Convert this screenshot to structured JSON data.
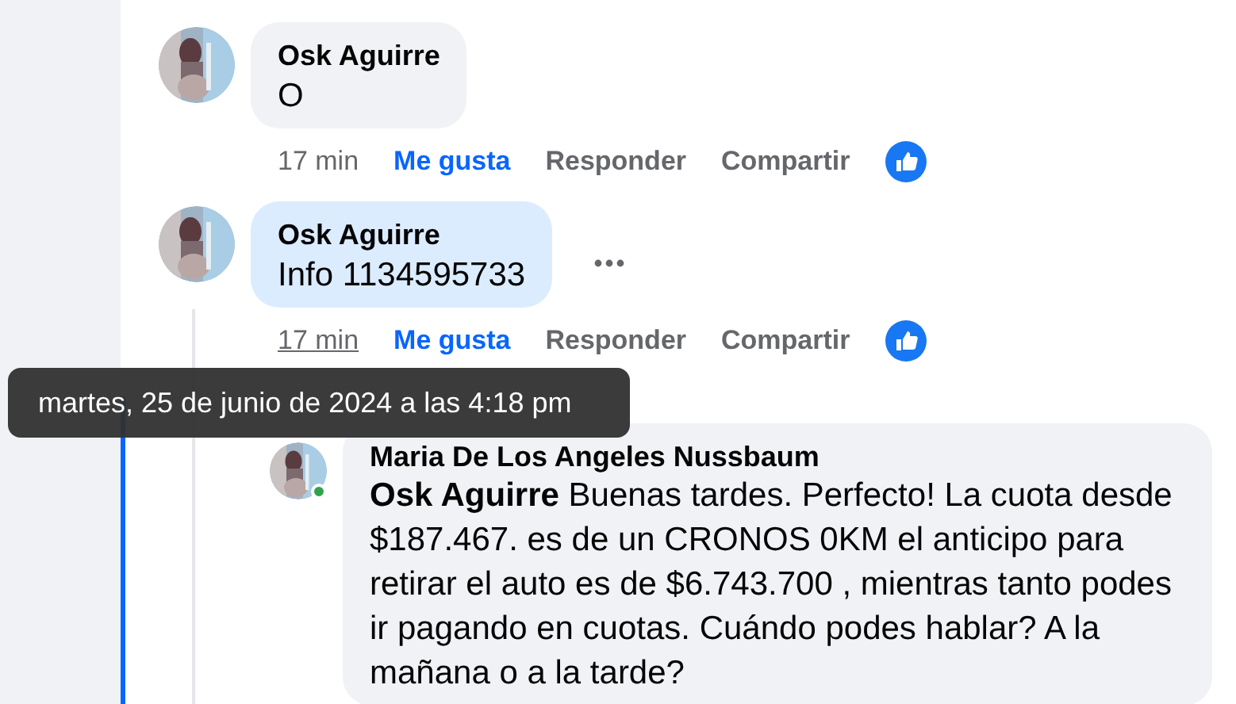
{
  "comments": [
    {
      "author": "Osk Aguirre",
      "text": "O",
      "highlighted": false,
      "time": "17 min",
      "time_hovered": false,
      "actions": [
        {
          "label": "Me gusta",
          "active": true
        },
        {
          "label": "Responder",
          "active": false
        },
        {
          "label": "Compartir",
          "active": false
        }
      ],
      "reacted": true
    },
    {
      "author": "Osk Aguirre",
      "text": "Info 1134595733",
      "highlighted": true,
      "more_menu": true,
      "time": "17 min",
      "time_hovered": true,
      "actions": [
        {
          "label": "Me gusta",
          "active": true
        },
        {
          "label": "Responder",
          "active": false
        },
        {
          "label": "Compartir",
          "active": false
        }
      ],
      "reacted": true
    },
    {
      "author": "Maria De Los Angeles Nussbaum",
      "text": "**Osk Aguirre** Buenas tardes. Perfecto! La cuota desde $187.467. es de un CRONOS 0KM el anticipo para retirar el auto es de $6.743.700 , mientras tanto podes ir pagando en cuotas. Cuándo podes hablar? A la mañana o a la tarde?",
      "highlighted": false,
      "online": true,
      "reply": true
    }
  ],
  "tooltip": "martes, 25 de junio de 2024 a las 4:18 pm"
}
